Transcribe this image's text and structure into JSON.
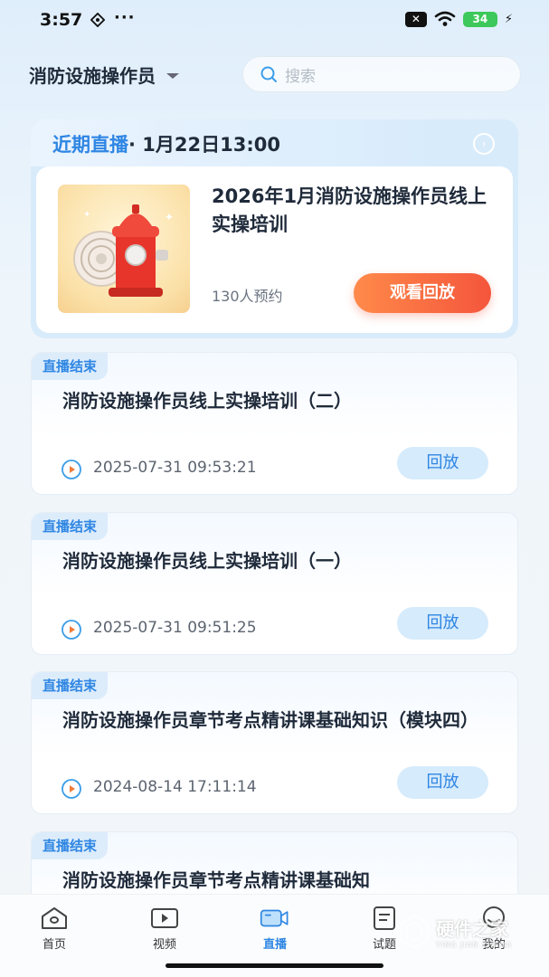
{
  "status_bar": {
    "time": "3:57",
    "dots": "···",
    "x_badge": "✕",
    "battery": "34"
  },
  "header": {
    "course_name": "消防设施操作员",
    "search_placeholder": "搜索"
  },
  "live": {
    "label": "近期直播",
    "datetime": "· 1月22日13:00",
    "course_title": "2026年1月消防设施操作员线上实操培训",
    "reserve_count": "130人预约",
    "watch_button": "观看回放"
  },
  "list": [
    {
      "badge": "直播结束",
      "title": "消防设施操作员线上实操培训（二）",
      "time": "2025-07-31 09:53:21",
      "button": "回放"
    },
    {
      "badge": "直播结束",
      "title": "消防设施操作员线上实操培训（一）",
      "time": "2025-07-31 09:51:25",
      "button": "回放"
    },
    {
      "badge": "直播结束",
      "title": "消防设施操作员章节考点精讲课基础知识（模块四）",
      "time": "2024-08-14 17:11:14",
      "button": "回放"
    },
    {
      "badge": "直播结束",
      "title": "消防设施操作员章节考点精讲课基础知",
      "time": "",
      "button": ""
    }
  ],
  "nav": {
    "items": [
      {
        "label": "首页",
        "icon": "home-icon"
      },
      {
        "label": "视频",
        "icon": "video-icon"
      },
      {
        "label": "直播",
        "icon": "live-camera-icon",
        "active": true
      },
      {
        "label": "试题",
        "icon": "exam-icon"
      },
      {
        "label": "我的",
        "icon": "profile-icon"
      }
    ]
  },
  "watermark": {
    "name": "硬件之家",
    "domain": "YING JIAN ZHI JIA"
  },
  "colors": {
    "accent": "#2f86e3",
    "watch_button": "#f4553c",
    "background": "#eef5fb"
  }
}
